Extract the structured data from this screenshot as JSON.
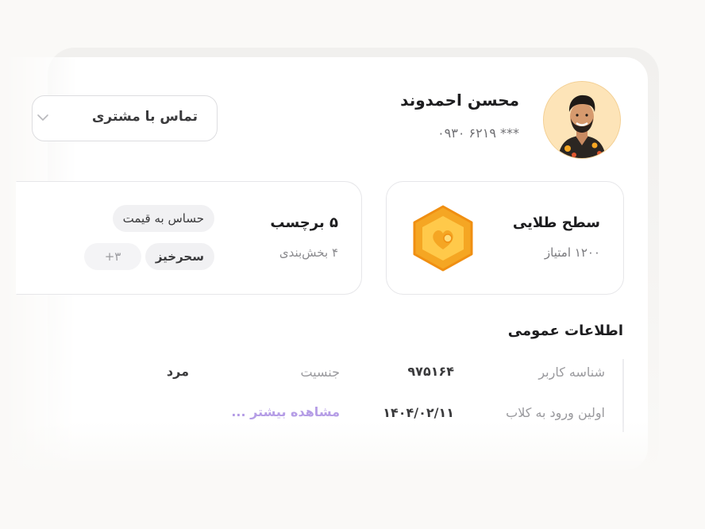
{
  "profile": {
    "name": "محسن احمدوند",
    "phone": "۰۹۳۰ ۶۲۱۹ ***"
  },
  "contact": {
    "label": "تماس با مشتری"
  },
  "level": {
    "title": "سطح طلایی",
    "points": "۱۲۰۰ امتیاز"
  },
  "tags": {
    "title": "۵ برچسب",
    "subtitle": "۴ بخش‌بندی",
    "chips": [
      "حساس به قیمت",
      "سحرخیز",
      "+۳"
    ]
  },
  "general_info": {
    "title": "اطلاعات عمومی",
    "rows": [
      {
        "label": "شناسه کاربر",
        "value": "۹۷۵۱۶۴"
      },
      {
        "label": "جنسیت",
        "value": "مرد"
      },
      {
        "label": "اولین ورود به کلاب",
        "value": "۱۴۰۴/۰۲/۱۱"
      }
    ],
    "more": "مشاهده بیشتر ..."
  },
  "colors": {
    "accent": "#b59de6",
    "gold": "#f5a623",
    "avatar_bg": "#fde4b8"
  }
}
